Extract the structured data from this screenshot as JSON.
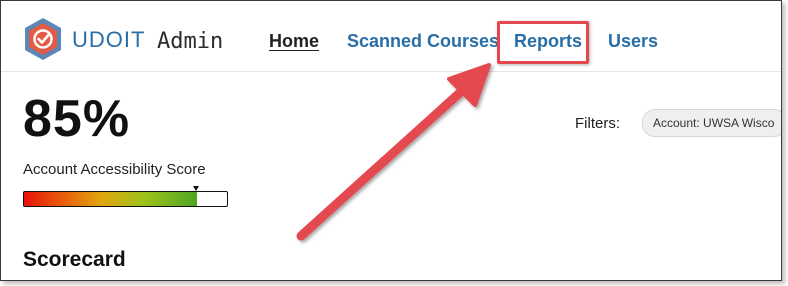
{
  "header": {
    "brand_name": "UDOIT",
    "brand_suffix": "Admin",
    "logo_icon": "udoit-shield-check-logo",
    "nav": [
      {
        "label": "Home",
        "active": true
      },
      {
        "label": "Scanned Courses",
        "active": false
      },
      {
        "label": "Reports",
        "active": false,
        "highlighted": true
      },
      {
        "label": "Users",
        "active": false
      }
    ]
  },
  "score": {
    "value": "85%",
    "label": "Account Accessibility Score",
    "meter_fraction": 0.85
  },
  "filters": {
    "label": "Filters:",
    "chips": [
      "Account: UWSA Wisco"
    ]
  },
  "sections": {
    "scorecard_title": "Scorecard"
  },
  "colors": {
    "brand_blue": "#2a6ea8",
    "highlight_red": "#e4484f",
    "meter_low": "#e8110b",
    "meter_high": "#4fa521"
  },
  "annotation": {
    "arrow_icon": "red-arrow-pointing-to-reports"
  }
}
